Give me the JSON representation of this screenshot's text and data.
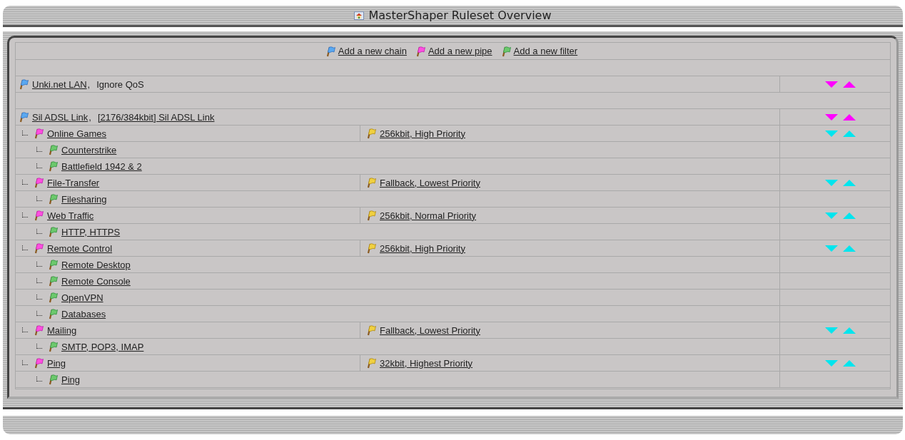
{
  "window": {
    "title": "MasterShaper Ruleset Overview"
  },
  "actions": [
    {
      "label": "Add a new chain",
      "kind": "chain"
    },
    {
      "label": "Add a new pipe",
      "kind": "pipe"
    },
    {
      "label": "Add a new filter",
      "kind": "filter"
    }
  ],
  "chains": [
    {
      "name": "Unki.net LAN",
      "separator": ",",
      "service_level": "Ignore QoS",
      "service_level_link": false
    },
    {
      "name": "Sil ADSL Link",
      "separator": ",",
      "service_level": "[2176/384kbit] Sil ADSL Link",
      "service_level_link": true,
      "pipes": [
        {
          "name": "Online Games",
          "service_level": "256kbit, High Priority",
          "filters": [
            "Counterstrike",
            "Battlefield 1942 & 2"
          ]
        },
        {
          "name": "File-Transfer",
          "service_level": "Fallback, Lowest Priority",
          "filters": [
            "Filesharing"
          ]
        },
        {
          "name": "Web Traffic",
          "service_level": "256kbit, Normal Priority",
          "filters": [
            "HTTP, HTTPS"
          ]
        },
        {
          "name": "Remote Control",
          "service_level": "256kbit, High Priority",
          "filters": [
            "Remote Desktop",
            "Remote Console",
            "OpenVPN",
            "Databases"
          ]
        },
        {
          "name": "Mailing",
          "service_level": "Fallback, Lowest Priority",
          "filters": [
            "SMTP, POP3, IMAP"
          ]
        },
        {
          "name": "Ping",
          "service_level": "32kbit, Highest Priority",
          "filters": [
            "Ping"
          ]
        }
      ]
    }
  ]
}
